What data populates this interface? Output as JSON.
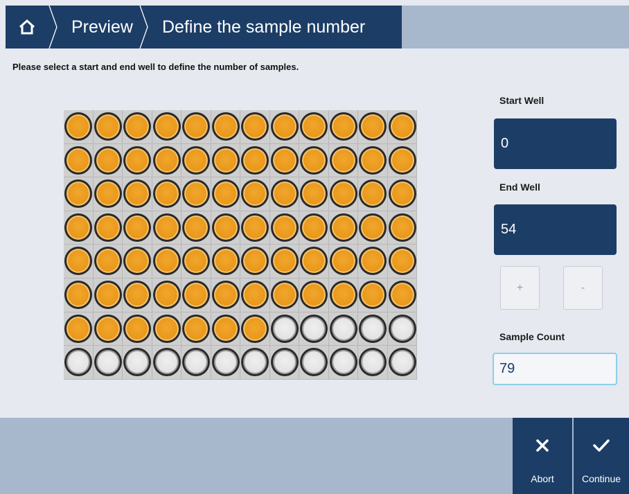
{
  "header": {
    "home_icon": "home-icon",
    "breadcrumbs": [
      "Preview",
      "Define the sample number"
    ]
  },
  "instruction": "Please select a start and end well to define the number of samples.",
  "plate": {
    "rows": 8,
    "columns": 12,
    "selected_wells": 79,
    "total_wells": 96,
    "selected_color": "#e9991c",
    "unselected_color": "#e2e2e2"
  },
  "start_well": {
    "label": "Start Well",
    "value": "0"
  },
  "end_well": {
    "label": "End Well",
    "value": "54"
  },
  "stepper": {
    "plus": "+",
    "minus": "-"
  },
  "sample_count": {
    "label": "Sample Count",
    "value": "79"
  },
  "footer": {
    "abort": {
      "label": "Abort",
      "icon": "close-icon"
    },
    "continue": {
      "label": "Continue",
      "icon": "check-icon"
    }
  },
  "colors": {
    "primary": "#1c3d66",
    "bar": "#a7b7cc",
    "background": "#e6e9ef",
    "count_border": "#8fcdea"
  }
}
